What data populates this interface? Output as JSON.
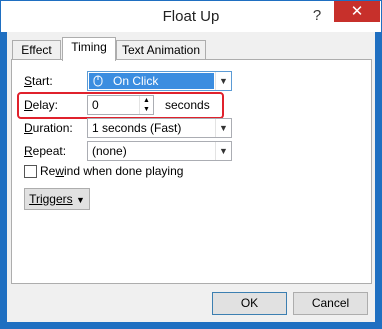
{
  "window": {
    "title": "Float Up",
    "help_icon": "?",
    "close_icon": "✕"
  },
  "tabs": [
    {
      "label": "Effect"
    },
    {
      "label": "Timing"
    },
    {
      "label": "Text Animation"
    }
  ],
  "fields": {
    "start": {
      "label": "Start:",
      "value": "On Click"
    },
    "delay": {
      "label": "Delay:",
      "value": "0",
      "unit": "seconds"
    },
    "duration": {
      "label": "Duration:",
      "value": "1 seconds (Fast)"
    },
    "repeat": {
      "label": "Repeat:",
      "value": "(none)"
    }
  },
  "rewind": {
    "label": "Rewind when done playing",
    "checked": false
  },
  "triggers": {
    "label": "Triggers"
  },
  "buttons": {
    "ok": "OK",
    "cancel": "Cancel"
  },
  "highlight_color": "#e0212c",
  "accent_color": "#1f6fc1"
}
